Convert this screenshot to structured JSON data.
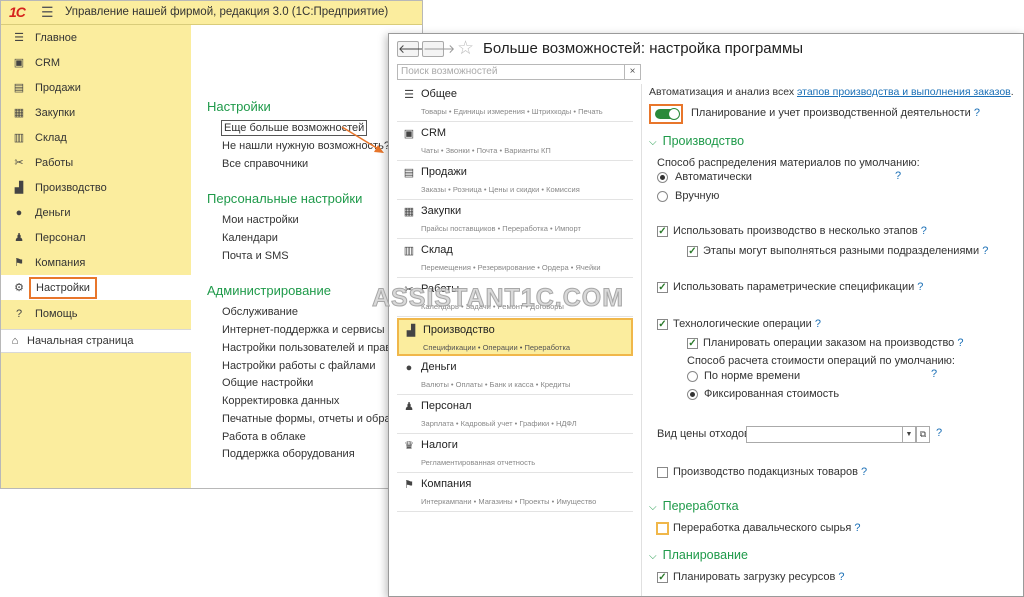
{
  "back_window": {
    "app_title": "Управление нашей фирмой, редакция 3.0  (1С:Предприятие)",
    "logo_text": "1С",
    "sidebar": [
      {
        "label": "Главное",
        "icon": "menu-icon"
      },
      {
        "label": "CRM",
        "icon": "crm-icon"
      },
      {
        "label": "Продажи",
        "icon": "cart-icon"
      },
      {
        "label": "Закупки",
        "icon": "truck-icon"
      },
      {
        "label": "Склад",
        "icon": "warehouse-icon"
      },
      {
        "label": "Работы",
        "icon": "tools-icon"
      },
      {
        "label": "Производство",
        "icon": "factory-icon"
      },
      {
        "label": "Деньги",
        "icon": "money-icon"
      },
      {
        "label": "Персонал",
        "icon": "people-icon"
      },
      {
        "label": "Компания",
        "icon": "flag-icon"
      },
      {
        "label": "Настройки",
        "icon": "gear-icon"
      },
      {
        "label": "Помощь",
        "icon": "help-icon"
      }
    ],
    "homepage_label": "Начальная страница",
    "sections": {
      "settings": {
        "title": "Настройки",
        "links": [
          "Еще больше возможностей",
          "Не нашли нужную возможность?",
          "Все справочники"
        ]
      },
      "personal": {
        "title": "Персональные настройки",
        "links": [
          "Мои настройки",
          "Календари",
          "Почта и SMS"
        ]
      },
      "admin": {
        "title": "Администрирование",
        "links": [
          "Обслуживание",
          "Интернет-поддержка и сервисы",
          "Настройки пользователей и прав",
          "Настройки работы с файлами",
          "Общие настройки",
          "Корректировка данных",
          "Печатные формы, отчеты и обработки",
          "Работа в облаке",
          "Поддержка оборудования"
        ]
      }
    }
  },
  "front_window": {
    "title": "Больше возможностей: настройка программы",
    "nav_back": "🡐",
    "nav_forward": "🡒",
    "search_placeholder": "Поиск возможностей",
    "search_clear": "×",
    "categories": [
      {
        "name": "Общее",
        "sub": "Товары • Единицы измерения • Штрихкоды • Печать",
        "icon": "menu-icon"
      },
      {
        "name": "CRM",
        "sub": "Чаты • Звонки • Почта • Варианты КП",
        "icon": "crm-icon"
      },
      {
        "name": "Продажи",
        "sub": "Заказы • Розница • Цены и скидки • Комиссия",
        "icon": "cart-icon"
      },
      {
        "name": "Закупки",
        "sub": "Прайсы поставщиков • Переработка • Импорт",
        "icon": "truck-icon"
      },
      {
        "name": "Склад",
        "sub": "Перемещения • Резервирование • Ордера • Ячейки",
        "icon": "warehouse-icon"
      },
      {
        "name": "Работы",
        "sub": "Календарь • Задачи • Ремонт • Договоры",
        "icon": "tools-icon"
      },
      {
        "name": "Производство",
        "sub": "Спецификации • Операции • Переработка",
        "icon": "factory-icon"
      },
      {
        "name": "Деньги",
        "sub": "Валюты • Оплаты • Банк и касса • Кредиты",
        "icon": "money-icon"
      },
      {
        "name": "Персонал",
        "sub": "Зарплата • Кадровый учет • Графики • НДФЛ",
        "icon": "people-icon"
      },
      {
        "name": "Налоги",
        "sub": "Регламентированная отчетность",
        "icon": "taxes-icon"
      },
      {
        "name": "Компания",
        "sub": "Интеркампани • Магазины • Проекты • Имущество",
        "icon": "flag-icon"
      }
    ],
    "right": {
      "intro_text": "Автоматизация и анализ всех ",
      "intro_link": "этапов производства и выполнения заказов",
      "intro_end": ".",
      "toggle_label": "Планирование и учет производственной деятельности",
      "toggle_on": true,
      "group_production": "Производство",
      "distribution_label": "Способ распределения материалов по умолчанию:",
      "radio_auto": "Автоматически",
      "radio_manual": "Вручную",
      "cb_multistage": "Использовать производство в несколько этапов",
      "cb_stages_divisions": "Этапы могут выполняться разными подразделениями",
      "cb_param_specs": "Использовать параметрические спецификации",
      "cb_tech_ops": "Технологические операции",
      "cb_plan_ops": "Планировать операции заказом на производство",
      "ops_cost_label": "Способ расчета стоимости операций по умолчанию:",
      "radio_norm": "По норме времени",
      "radio_fixed": "Фиксированная стоимость",
      "waste_price_label": "Вид цены отходов:",
      "cb_excise": "Производство подакцизных товаров",
      "group_processing": "Переработка",
      "cb_toll": "Переработка давальческого сырья",
      "group_planning": "Планирование",
      "cb_plan_resources": "Планировать загрузку ресурсов",
      "help_mark": "?"
    }
  },
  "watermark": "ASSISTANT1C.COM",
  "colors": {
    "sidebar_bg": "#fbed9e",
    "section_green": "#1f9a4a",
    "highlight_orange": "#e8762b",
    "link_blue": "#1a6fb6",
    "toggle_green": "#2a8a3a"
  }
}
